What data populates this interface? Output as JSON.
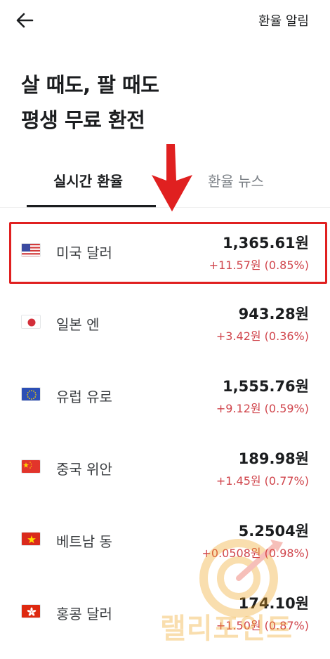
{
  "header": {
    "alert_label": "환율 알림"
  },
  "headline": {
    "line1": "살 때도, 팔 때도",
    "line2": "평생 무료 환전"
  },
  "tabs": [
    {
      "label": "실시간 환율",
      "active": true
    },
    {
      "label": "환율 뉴스",
      "active": false
    }
  ],
  "rates": [
    {
      "flag": "us-flag-icon",
      "name": "미국 달러",
      "price": "1,365.61원",
      "change": "+11.57원 (0.85%)"
    },
    {
      "flag": "jp-flag-icon",
      "name": "일본 엔",
      "price": "943.28원",
      "change": "+3.42원 (0.36%)"
    },
    {
      "flag": "eu-flag-icon",
      "name": "유럽 유로",
      "price": "1,555.76원",
      "change": "+9.12원 (0.59%)"
    },
    {
      "flag": "cn-flag-icon",
      "name": "중국 위안",
      "price": "189.98원",
      "change": "+1.45원 (0.77%)"
    },
    {
      "flag": "vn-flag-icon",
      "name": "베트남 동",
      "price": "5.2504원",
      "change": "+0.0508원 (0.98%)"
    },
    {
      "flag": "hk-flag-icon",
      "name": "홍콩 달러",
      "price": "174.10원",
      "change": "+1.50원 (0.87%)"
    }
  ],
  "watermark": {
    "text": "랠리포인트"
  },
  "colors": {
    "positive_change": "#d0454c",
    "annotation_red": "#e02020",
    "watermark_orange": "#f0a21a"
  }
}
